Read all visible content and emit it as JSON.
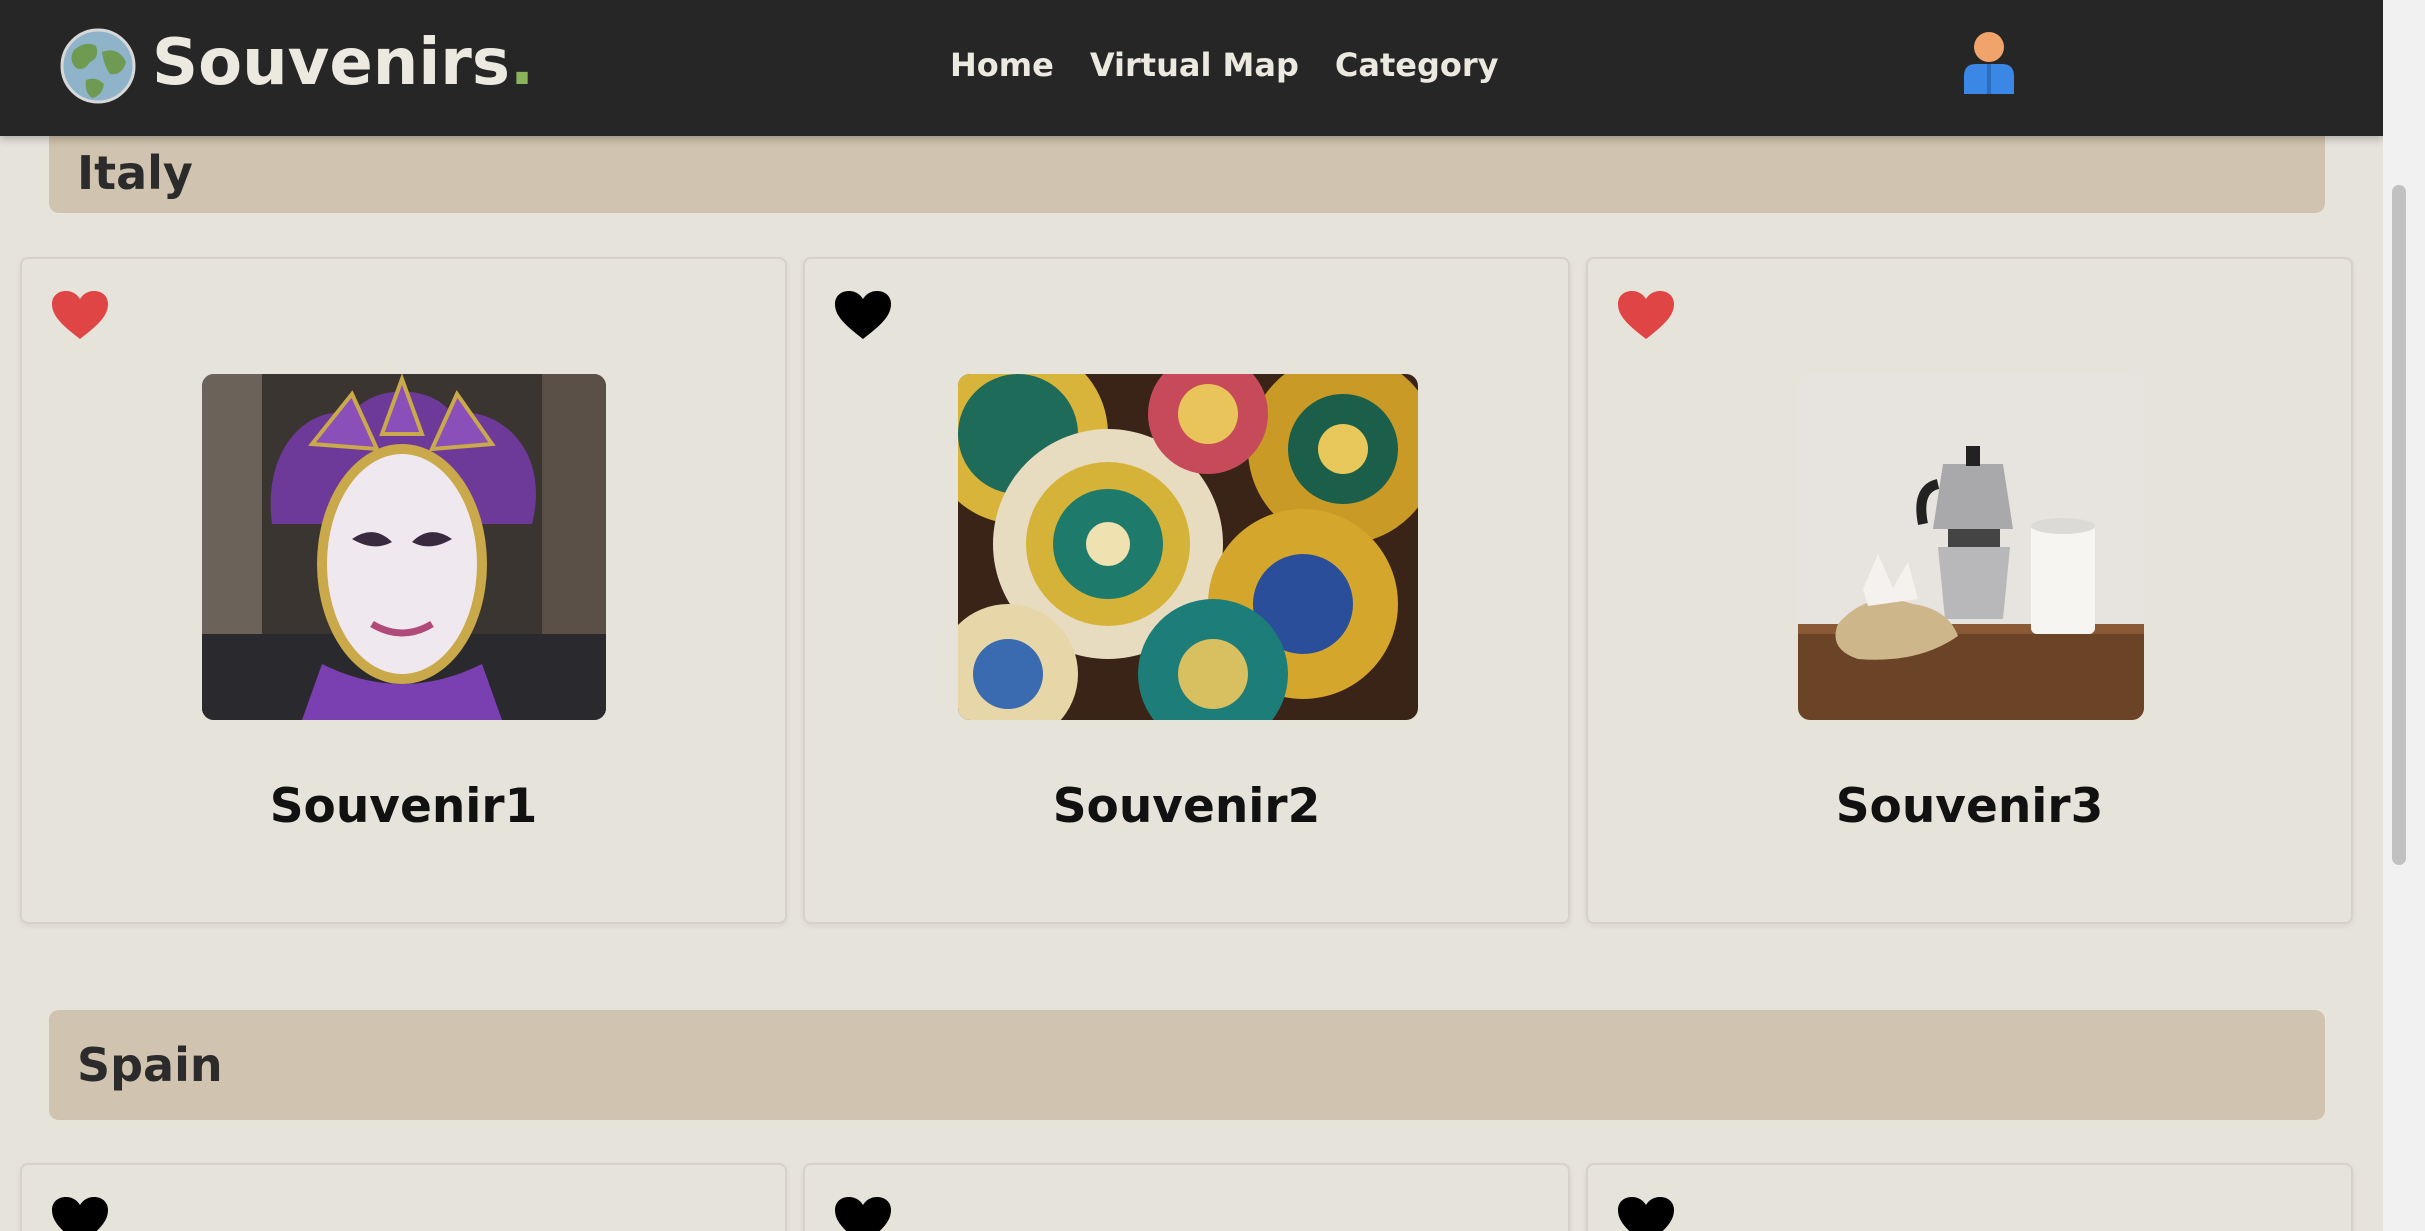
{
  "app": {
    "brand": "Souvenirs",
    "brand_dot": "."
  },
  "nav": {
    "links": [
      "Home",
      "Virtual Map",
      "Category"
    ]
  },
  "colors": {
    "navbar_bg": "#262626",
    "brand_dot": "#8ab45a",
    "page_bg": "#e6e3da",
    "section_bg": "#d0c3af",
    "heart_liked": "#e04545",
    "heart_default": "#000000"
  },
  "sections": [
    {
      "title": "Italy",
      "items": [
        {
          "name": "Souvenir1",
          "liked": true,
          "image": "venetian carnival mask"
        },
        {
          "name": "Souvenir2",
          "liked": false,
          "image": "painted ceramic plates"
        },
        {
          "name": "Souvenir3",
          "liked": true,
          "image": "moka coffee pot"
        }
      ]
    },
    {
      "title": "Spain",
      "items": [
        {
          "liked": false
        },
        {
          "liked": false
        },
        {
          "liked": false
        }
      ]
    }
  ],
  "icons": {
    "logo": "globe-icon",
    "user": "user-icon",
    "favorite": "heart-icon"
  }
}
